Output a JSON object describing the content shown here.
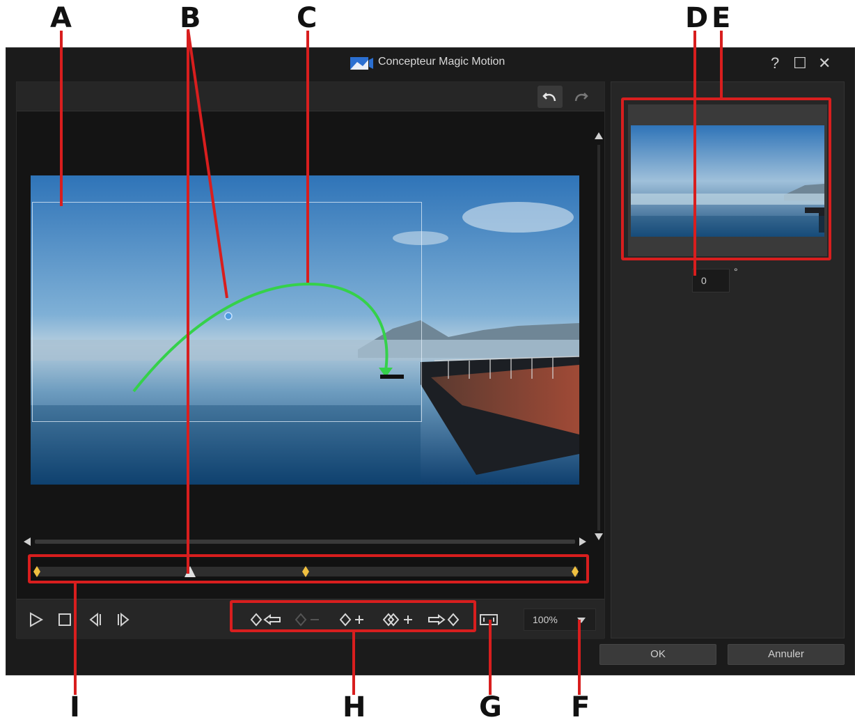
{
  "window": {
    "title": "Concepteur Magic Motion",
    "help_glyph": "?",
    "maximize_glyph": "☐",
    "close_glyph": "✕"
  },
  "toolbar": {
    "undo_icon": "undo-icon",
    "redo_icon": "redo-icon"
  },
  "timeline": {
    "keyframe_color": "#f0c040",
    "keyframes": 3
  },
  "transport": {
    "play": "play-icon",
    "stop": "stop-icon",
    "prev_frame": "previous-frame-icon",
    "next_frame": "next-frame-icon"
  },
  "keyframe_tools": [
    "previous-keyframe-icon",
    "remove-keyframe-icon",
    "add-keyframe-icon",
    "duplicate-keyframe-icon",
    "next-keyframe-icon"
  ],
  "zoom": {
    "value": "100%"
  },
  "rotation": {
    "value": "0",
    "unit": "°"
  },
  "buttons": {
    "ok": "OK",
    "cancel": "Annuler"
  },
  "callouts": {
    "A": "A",
    "B": "B",
    "C": "C",
    "D": "D",
    "E": "E",
    "F": "F",
    "G": "G",
    "H": "H",
    "I": "I"
  },
  "colors": {
    "annotation": "#d81e1e",
    "motion_path": "#35d14a",
    "window_bg": "#1b1b1b"
  }
}
